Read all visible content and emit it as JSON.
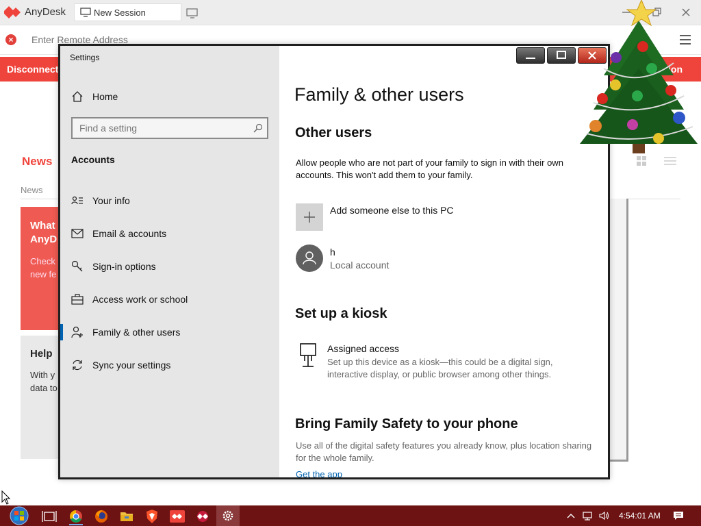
{
  "anydesk": {
    "app_name": "AnyDesk",
    "tab_label": "New Session",
    "address_placeholder": "Enter Remote Address",
    "banner_text": "Disconnected",
    "banner_right": "ion",
    "news_title": "News",
    "news_tab": "News",
    "card1_title": "What\nAnyD",
    "card1_text": "Check\nnew fe",
    "card2_title": "Help",
    "card2_text": "With y\ndata to",
    "accent_color": "#ef443b"
  },
  "settings": {
    "window_title": "Settings",
    "search_placeholder": "Find a setting",
    "category_heading": "Accounts",
    "nav": [
      {
        "label": "Home",
        "icon": "home-icon"
      },
      {
        "label": "Your info",
        "icon": "user-card-icon"
      },
      {
        "label": "Email & accounts",
        "icon": "mail-icon"
      },
      {
        "label": "Sign-in options",
        "icon": "key-icon"
      },
      {
        "label": "Access work or school",
        "icon": "briefcase-icon"
      },
      {
        "label": "Family & other users",
        "icon": "person-add-icon",
        "active": true
      },
      {
        "label": "Sync your settings",
        "icon": "sync-icon"
      }
    ],
    "main": {
      "page_title": "Family & other users",
      "other_users_title": "Other users",
      "other_users_desc": "Allow people who are not part of your family to sign in with their own accounts. This won't add them to your family.",
      "add_user_label": "Add someone else to this PC",
      "user_name": "h",
      "user_type": "Local account",
      "kiosk_title": "Set up a kiosk",
      "assigned_access_title": "Assigned access",
      "assigned_access_desc": "Set up this device as a kiosk—this could be a digital sign, interactive display, or public browser among other things.",
      "family_safety_title": "Bring Family Safety to your phone",
      "family_safety_desc": "Use all of the digital safety features you already know, plus location sharing for the whole family.",
      "get_app_link": "Get the app"
    },
    "accent_color": "#0063b1"
  },
  "taskbar": {
    "time": "4:54:01 AM",
    "color": "#6d1313"
  }
}
